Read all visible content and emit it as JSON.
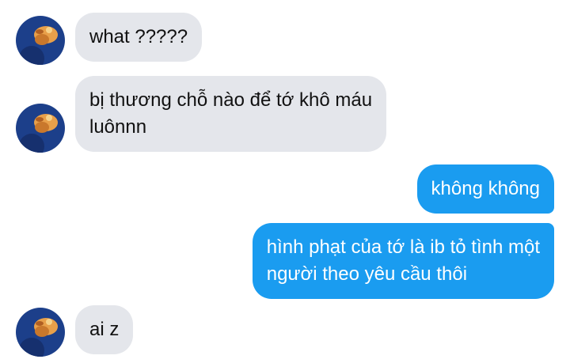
{
  "colors": {
    "incoming_bubble": "#e4e6eb",
    "outgoing_bubble": "#1a9cf0",
    "incoming_text": "#111111",
    "outgoing_text": "#ffffff"
  },
  "messages": [
    {
      "sender": "contact",
      "avatar_icon": "contact-avatar",
      "lines": [
        "what ?????"
      ]
    },
    {
      "sender": "contact",
      "avatar_icon": "contact-avatar",
      "lines": [
        "bị thương chỗ nào để tớ khô máu",
        "luônnn"
      ]
    },
    {
      "sender": "me",
      "lines": [
        "không không"
      ]
    },
    {
      "sender": "me",
      "lines": [
        "hình phạt của tớ là ib tỏ tình một",
        "người theo yêu cầu thôi"
      ]
    },
    {
      "sender": "contact",
      "avatar_icon": "contact-avatar",
      "lines": [
        "ai z"
      ]
    }
  ]
}
